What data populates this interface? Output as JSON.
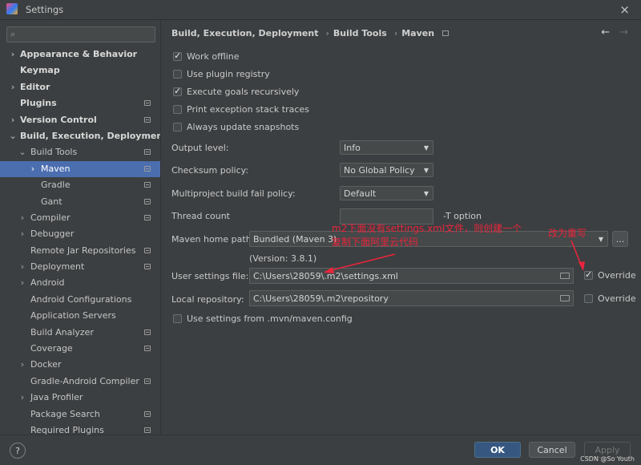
{
  "window": {
    "title": "Settings",
    "close_icon": "×"
  },
  "sidebar": {
    "search_placeholder": "",
    "items": [
      {
        "label": "Appearance & Behavior"
      },
      {
        "label": "Keymap"
      },
      {
        "label": "Editor"
      },
      {
        "label": "Plugins"
      },
      {
        "label": "Version Control"
      },
      {
        "label": "Build, Execution, Deployment"
      },
      {
        "label": "Build Tools"
      },
      {
        "label": "Maven"
      },
      {
        "label": "Gradle"
      },
      {
        "label": "Gant"
      },
      {
        "label": "Compiler"
      },
      {
        "label": "Debugger"
      },
      {
        "label": "Remote Jar Repositories"
      },
      {
        "label": "Deployment"
      },
      {
        "label": "Android"
      },
      {
        "label": "Android Configurations"
      },
      {
        "label": "Application Servers"
      },
      {
        "label": "Build Analyzer"
      },
      {
        "label": "Coverage"
      },
      {
        "label": "Docker"
      },
      {
        "label": "Gradle-Android Compiler"
      },
      {
        "label": "Java Profiler"
      },
      {
        "label": "Package Search"
      },
      {
        "label": "Required Plugins"
      }
    ]
  },
  "breadcrumb": {
    "items": [
      "Build, Execution, Deployment",
      "Build Tools",
      "Maven"
    ],
    "separator": "›"
  },
  "checkboxes": {
    "work_offline": {
      "label": "Work offline",
      "checked": true
    },
    "use_plugin_registry": {
      "label": "Use plugin registry",
      "checked": false
    },
    "execute_goals_recursively": {
      "label": "Execute goals recursively",
      "checked": true
    },
    "print_exception_stack_traces": {
      "label": "Print exception stack traces",
      "checked": false
    },
    "always_update_snapshots": {
      "label": "Always update snapshots",
      "checked": false
    },
    "use_settings_from_config": {
      "label": "Use settings from .mvn/maven.config",
      "checked": false
    }
  },
  "form": {
    "output_level": {
      "label": "Output level:",
      "value": "Info"
    },
    "checksum_policy": {
      "label": "Checksum policy:",
      "value": "No Global Policy"
    },
    "multiproject_fail_policy": {
      "label": "Multiproject build fail policy:",
      "value": "Default"
    },
    "thread_count": {
      "label": "Thread count",
      "value": "",
      "suffix": "-T option"
    },
    "maven_home": {
      "label": "Maven home path:",
      "value": "Bundled (Maven 3)",
      "browse": "...",
      "version": "(Version: 3.8.1)"
    },
    "user_settings": {
      "label": "User settings file:",
      "value": "C:\\Users\\28059\\.m2\\settings.xml",
      "override_label": "Override",
      "override_checked": true
    },
    "local_repository": {
      "label": "Local repository:",
      "value": "C:\\Users\\28059\\.m2\\repository",
      "override_label": "Override",
      "override_checked": false
    }
  },
  "annotations": {
    "line1": "m2下面没有settings.xml文件，则创建一个",
    "line2": "复制下面阿里云代码",
    "override_note": "改为重写",
    "color": "#e8253c"
  },
  "buttons": {
    "ok": "OK",
    "cancel": "Cancel",
    "apply": "Apply",
    "help": "?"
  },
  "watermark": "CSDN @So Youth"
}
